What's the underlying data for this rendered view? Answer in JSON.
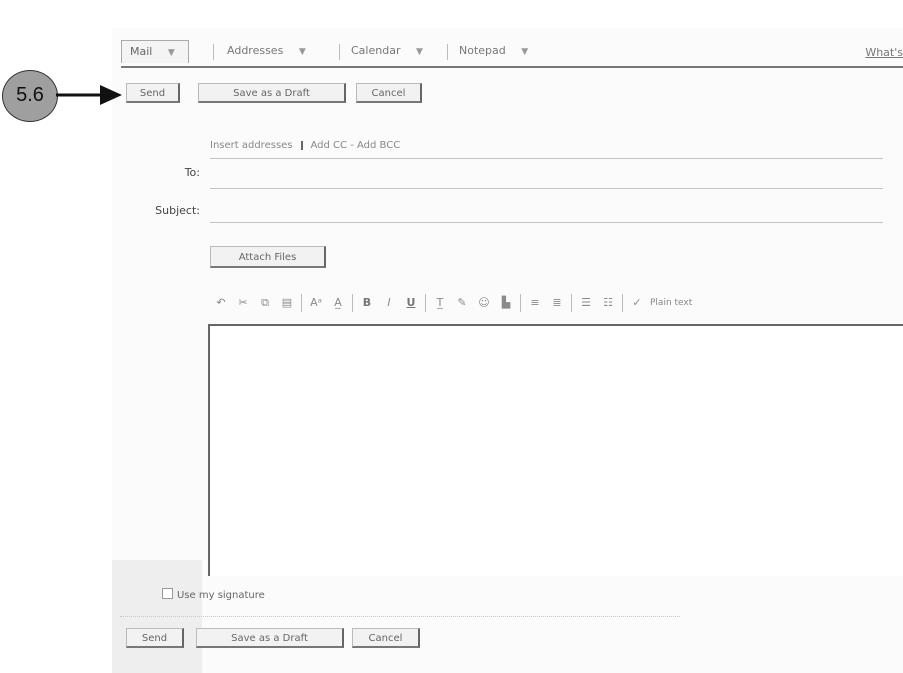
{
  "tabs": [
    {
      "label": "Mail",
      "active": true
    },
    {
      "label": "Addresses",
      "active": false
    },
    {
      "label": "Calendar",
      "active": false
    },
    {
      "label": "Notepad",
      "active": false
    }
  ],
  "whats_new_link": "What's",
  "top_actions": {
    "send": "Send",
    "save_draft": "Save as a Draft",
    "cancel": "Cancel"
  },
  "callout": {
    "number": "5.6"
  },
  "address_links": {
    "insert": "Insert addresses",
    "add_cc": "Add CC - Add BCC"
  },
  "fields": {
    "to_label": "To:",
    "subject_label": "Subject:"
  },
  "attach_button": "Attach Files",
  "toolbar": {
    "icons": [
      "undo-icon",
      "cut-icon",
      "copy-icon",
      "paste-icon",
      "font-icon",
      "font-size-icon",
      "bold-icon",
      "italic-icon",
      "underline-icon",
      "text-color-icon",
      "highlight-icon",
      "emoticon-icon",
      "stationery-icon",
      "align-left-icon",
      "align-right-icon",
      "bullet-list-icon",
      "numbered-list-icon",
      "spellcheck-icon"
    ],
    "label_tail": "Plain text"
  },
  "signature": {
    "label": "Use my signature",
    "checked": false
  },
  "bottom_actions": {
    "send": "Send",
    "save_draft": "Save as a Draft",
    "cancel": "Cancel"
  }
}
